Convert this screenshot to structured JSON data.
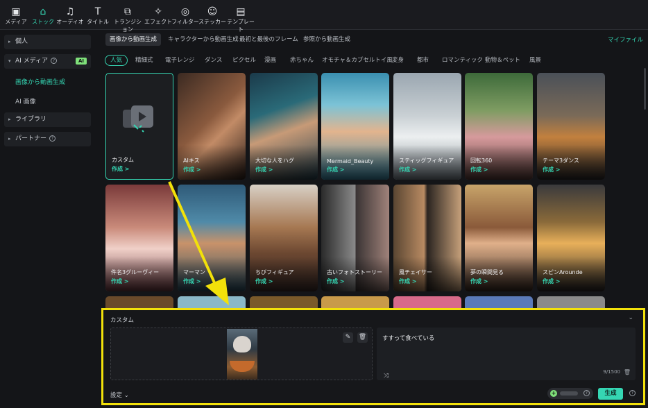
{
  "toolbar": {
    "items": [
      {
        "label": "メディア",
        "icon": "media-icon"
      },
      {
        "label": "ストック",
        "icon": "stock-icon"
      },
      {
        "label": "オーディオ",
        "icon": "audio-icon"
      },
      {
        "label": "タイトル",
        "icon": "title-icon"
      },
      {
        "label": "トランジション",
        "icon": "transition-icon"
      },
      {
        "label": "エフェクト",
        "icon": "effect-icon"
      },
      {
        "label": "フィルター",
        "icon": "filter-icon"
      },
      {
        "label": "ステッカー",
        "icon": "sticker-icon"
      },
      {
        "label": "テンプレート",
        "icon": "template-icon"
      }
    ],
    "active": "ストック"
  },
  "sidebar": {
    "personal": "個人",
    "ai_media": "AI メディア",
    "ai_badge": "AI",
    "sub_items": [
      "画像から動画生成",
      "AI 画像"
    ],
    "library": "ライブラリ",
    "partner": "パートナー"
  },
  "tabs": [
    "画像から動画生成",
    "キャラクターから動画生成",
    "最初と最後のフレーム",
    "参照から動画生成"
  ],
  "my_files": "マイファイル",
  "categories": [
    "人気",
    "精細式",
    "電子レンジ",
    "ダンス",
    "ピクセル",
    "漫画",
    "赤ちゃん",
    "オモチャ＆カプセルトイ風",
    "変身",
    "都市",
    "ロマンティック",
    "動物＆ペット",
    "風景"
  ],
  "cards": [
    {
      "title": "カスタム",
      "action": "作成 >"
    },
    {
      "title": "AIキス",
      "action": "作成 >"
    },
    {
      "title": "大切な人をハグ",
      "action": "作成 >"
    },
    {
      "title": "Mermaid_Beauty",
      "action": "作成 >"
    },
    {
      "title": "スティッグフィギュア",
      "action": "作成 >"
    },
    {
      "title": "回転360",
      "action": "作成 >"
    },
    {
      "title": "テーマ3ダンス",
      "action": "作成 >"
    },
    {
      "title": "件名3グルーヴィー",
      "action": "作成 >"
    },
    {
      "title": "マーマン",
      "action": "作成 >"
    },
    {
      "title": "ちびフィギュア",
      "action": "作成 >"
    },
    {
      "title": "古いフォトストーリー",
      "action": "作成 >"
    },
    {
      "title": "風チェイサー",
      "action": "作成 >"
    },
    {
      "title": "夢の瞬間見る",
      "action": "作成 >"
    },
    {
      "title": "スピンArounde",
      "action": "作成 >"
    }
  ],
  "panel": {
    "title": "カスタム",
    "prompt": "すすって食べている",
    "counter": "9/1500",
    "settings": "設定",
    "generate": "生成"
  },
  "colors": {
    "accent": "#35d6b3",
    "highlight": "#f2e10a"
  }
}
